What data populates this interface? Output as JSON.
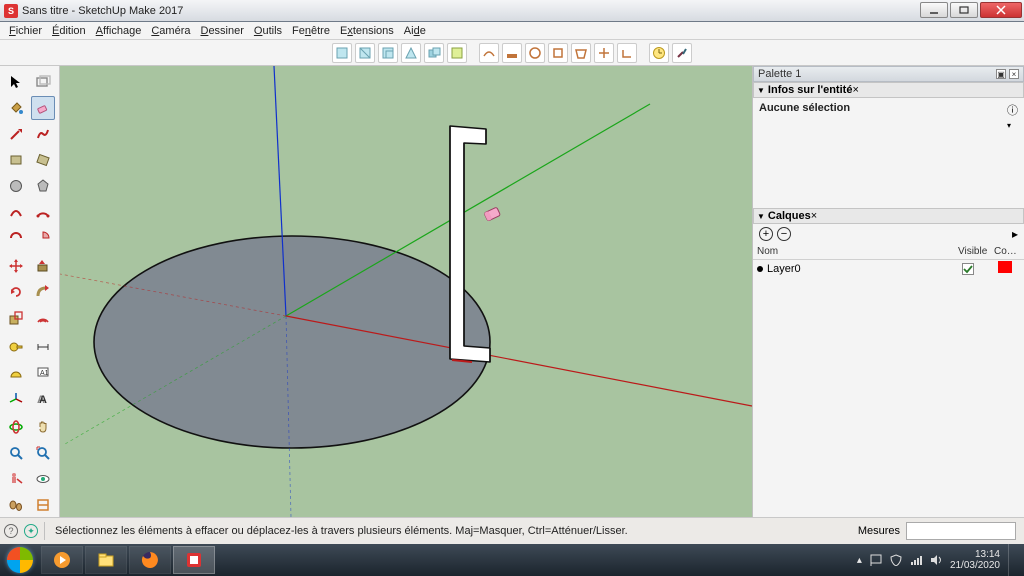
{
  "window": {
    "title": "Sans titre - SketchUp Make 2017",
    "app_icon_letter": "S"
  },
  "menu": {
    "items": [
      {
        "label": "Fichier",
        "u": 0
      },
      {
        "label": "Édition",
        "u": 0
      },
      {
        "label": "Affichage",
        "u": 0
      },
      {
        "label": "Caméra",
        "u": 0
      },
      {
        "label": "Dessiner",
        "u": 0
      },
      {
        "label": "Outils",
        "u": 0
      },
      {
        "label": "Fenêtre",
        "u": 2
      },
      {
        "label": "Extensions",
        "u": 1
      },
      {
        "label": "Aide",
        "u": 2
      }
    ]
  },
  "panels": {
    "palette_title": "Palette 1",
    "entity_title": "Infos sur l'entité",
    "entity_body": "Aucune sélection",
    "layers_title": "Calques",
    "layers_headers": {
      "name": "Nom",
      "visible": "Visible",
      "color": "Co…"
    },
    "layers": [
      {
        "name": "Layer0",
        "visible": true,
        "color": "#ff1a1a"
      }
    ]
  },
  "status": {
    "hint": "Sélectionnez les éléments à effacer ou déplacez-les à travers plusieurs éléments. Maj=Masquer, Ctrl=Atténuer/Lisser.",
    "measure_label": "Mesures"
  },
  "taskbar": {
    "clock_time": "13:14",
    "clock_date": "21/03/2020"
  }
}
